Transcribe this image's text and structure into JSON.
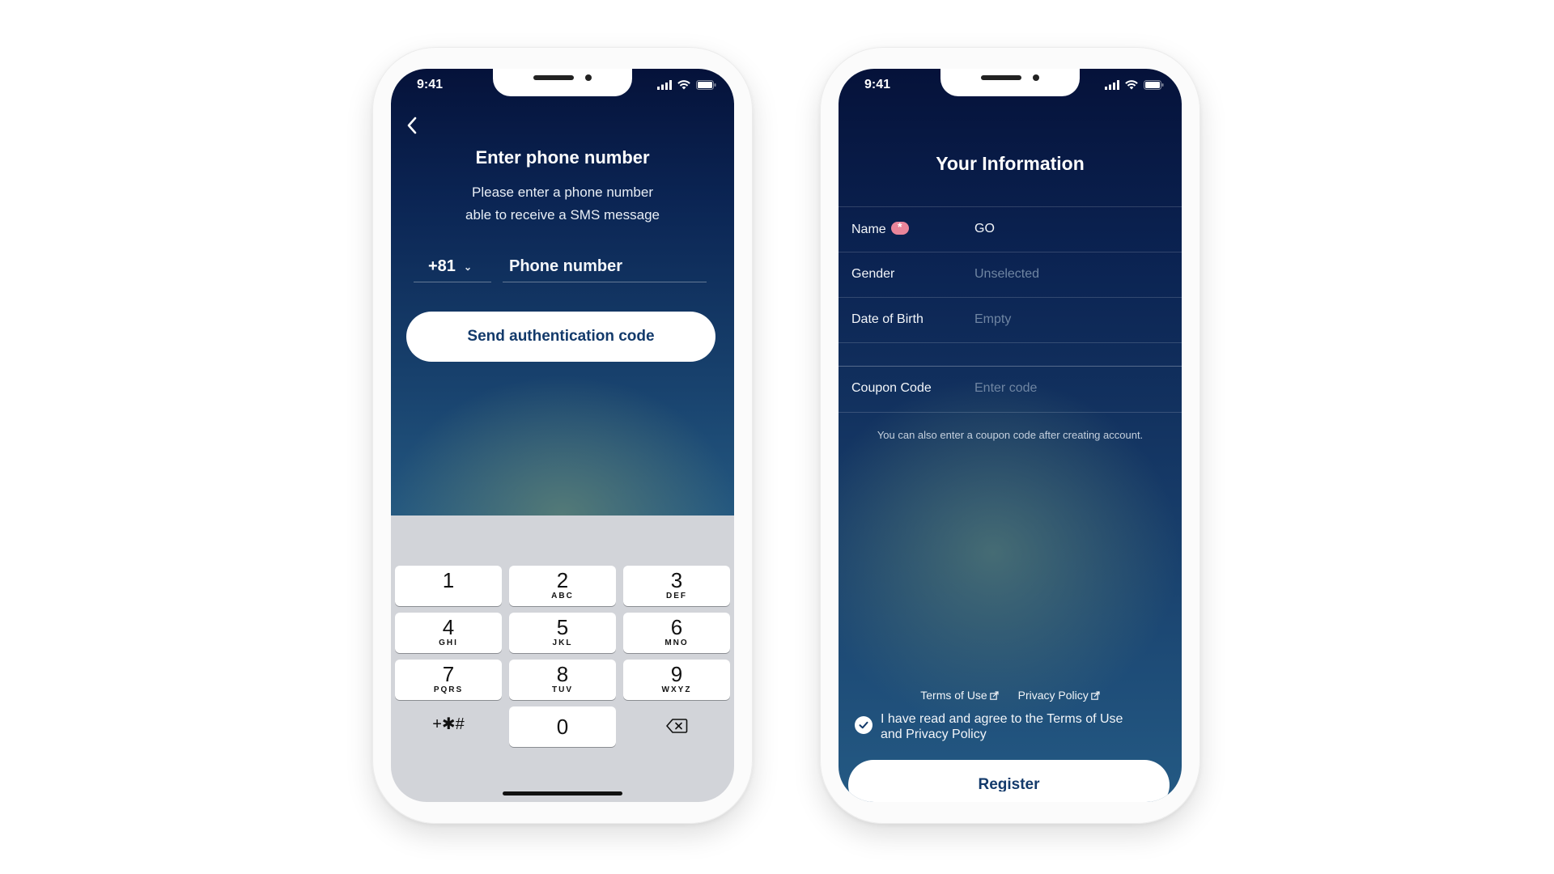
{
  "left_phone": {
    "status": {
      "time": "9:41"
    },
    "title": "Enter phone number",
    "subtitle_line1": "Please enter a phone number",
    "subtitle_line2": "able to receive a SMS message",
    "country_code": "+81",
    "phone_placeholder": "Phone number",
    "send_button": "Send authentication code",
    "keypad": {
      "keys": [
        {
          "digit": "1",
          "letters": ""
        },
        {
          "digit": "2",
          "letters": "ABC"
        },
        {
          "digit": "3",
          "letters": "DEF"
        },
        {
          "digit": "4",
          "letters": "GHI"
        },
        {
          "digit": "5",
          "letters": "JKL"
        },
        {
          "digit": "6",
          "letters": "MNO"
        },
        {
          "digit": "7",
          "letters": "PQRS"
        },
        {
          "digit": "8",
          "letters": "TUV"
        },
        {
          "digit": "9",
          "letters": "WXYZ"
        },
        {
          "digit": "0",
          "letters": ""
        }
      ],
      "symbols_label": "+✱#"
    }
  },
  "right_phone": {
    "status": {
      "time": "9:41"
    },
    "title": "Your Information",
    "fields": {
      "name": {
        "label": "Name",
        "value": "GO"
      },
      "gender": {
        "label": "Gender",
        "value": "Unselected"
      },
      "dob": {
        "label": "Date of Birth",
        "value": "Empty"
      },
      "coupon": {
        "label": "Coupon Code",
        "placeholder": "Enter code"
      }
    },
    "coupon_note": "You can also enter a coupon code after creating account.",
    "terms_link": "Terms of Use",
    "privacy_link": "Privacy Policy",
    "agree_text_line1": "I have read and agree to the Terms of Use",
    "agree_text_line2": "and Privacy Policy",
    "agree_checked": true,
    "register_button": "Register"
  },
  "colors": {
    "button_text": "#133a6b",
    "required_badge": "#e9859a",
    "keypad_bg": "#d2d4d9"
  }
}
